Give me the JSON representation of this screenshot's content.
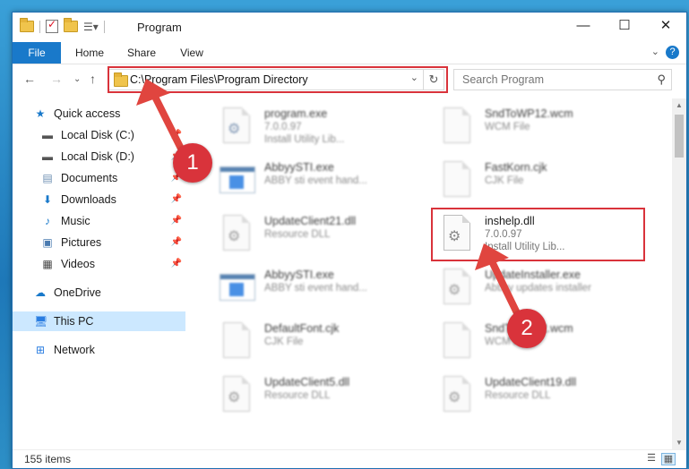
{
  "window": {
    "title": "Program"
  },
  "ribbon": {
    "tabs": [
      "File",
      "Home",
      "Share",
      "View"
    ]
  },
  "address": {
    "path": "C:\\Program Files\\Program Directory"
  },
  "search": {
    "placeholder": "Search Program"
  },
  "sidebar": {
    "items": [
      {
        "label": "Quick access",
        "icon": "star-icon"
      },
      {
        "label": "Local Disk (C:)",
        "icon": "drive-icon"
      },
      {
        "label": "Local Disk (D:)",
        "icon": "drive-icon"
      },
      {
        "label": "Documents",
        "icon": "documents-icon"
      },
      {
        "label": "Downloads",
        "icon": "download-icon"
      },
      {
        "label": "Music",
        "icon": "music-icon"
      },
      {
        "label": "Pictures",
        "icon": "pictures-icon"
      },
      {
        "label": "Videos",
        "icon": "videos-icon"
      },
      {
        "label": "OneDrive",
        "icon": "cloud-icon"
      },
      {
        "label": "This PC",
        "icon": "computer-icon"
      },
      {
        "label": "Network",
        "icon": "network-icon"
      }
    ]
  },
  "files": [
    {
      "name": "program.exe",
      "line1": "7.0.0.97",
      "line2": "Install Utility Lib...",
      "type": "setup"
    },
    {
      "name": "SndToWP12.wcm",
      "line1": "WCM File",
      "line2": "",
      "type": "doc"
    },
    {
      "name": "AbbyySTI.exe",
      "line1": "ABBY sti event hand...",
      "line2": "",
      "type": "exe"
    },
    {
      "name": "FastKorn.cjk",
      "line1": "CJK File",
      "line2": "",
      "type": "doc"
    },
    {
      "name": "UpdateClient21.dll",
      "line1": "Resource DLL",
      "line2": "",
      "type": "dll"
    },
    {
      "name": "inshelp.dll",
      "line1": "7.0.0.97",
      "line2": "Install Utility Lib...",
      "type": "dll"
    },
    {
      "name": "AbbyySTI.exe",
      "line1": "ABBY sti event hand...",
      "line2": "",
      "type": "exe"
    },
    {
      "name": "UpdateInstaller.exe",
      "line1": "Abbyy updates installer",
      "line2": "",
      "type": "dll"
    },
    {
      "name": "DefaultFont.cjk",
      "line1": "CJK File",
      "line2": "",
      "type": "doc"
    },
    {
      "name": "SndToWP12.wcm",
      "line1": "WCM File",
      "line2": "",
      "type": "doc"
    },
    {
      "name": "UpdateClient5.dll",
      "line1": "Resource DLL",
      "line2": "",
      "type": "dll"
    },
    {
      "name": "UpdateClient19.dll",
      "line1": "Resource DLL",
      "line2": "",
      "type": "dll"
    }
  ],
  "status": {
    "count": "155 items"
  },
  "annotations": {
    "step1": "1",
    "step2": "2"
  },
  "colors": {
    "accent": "#1979ca",
    "highlight": "#d9333b",
    "selected": "#cce8ff"
  }
}
